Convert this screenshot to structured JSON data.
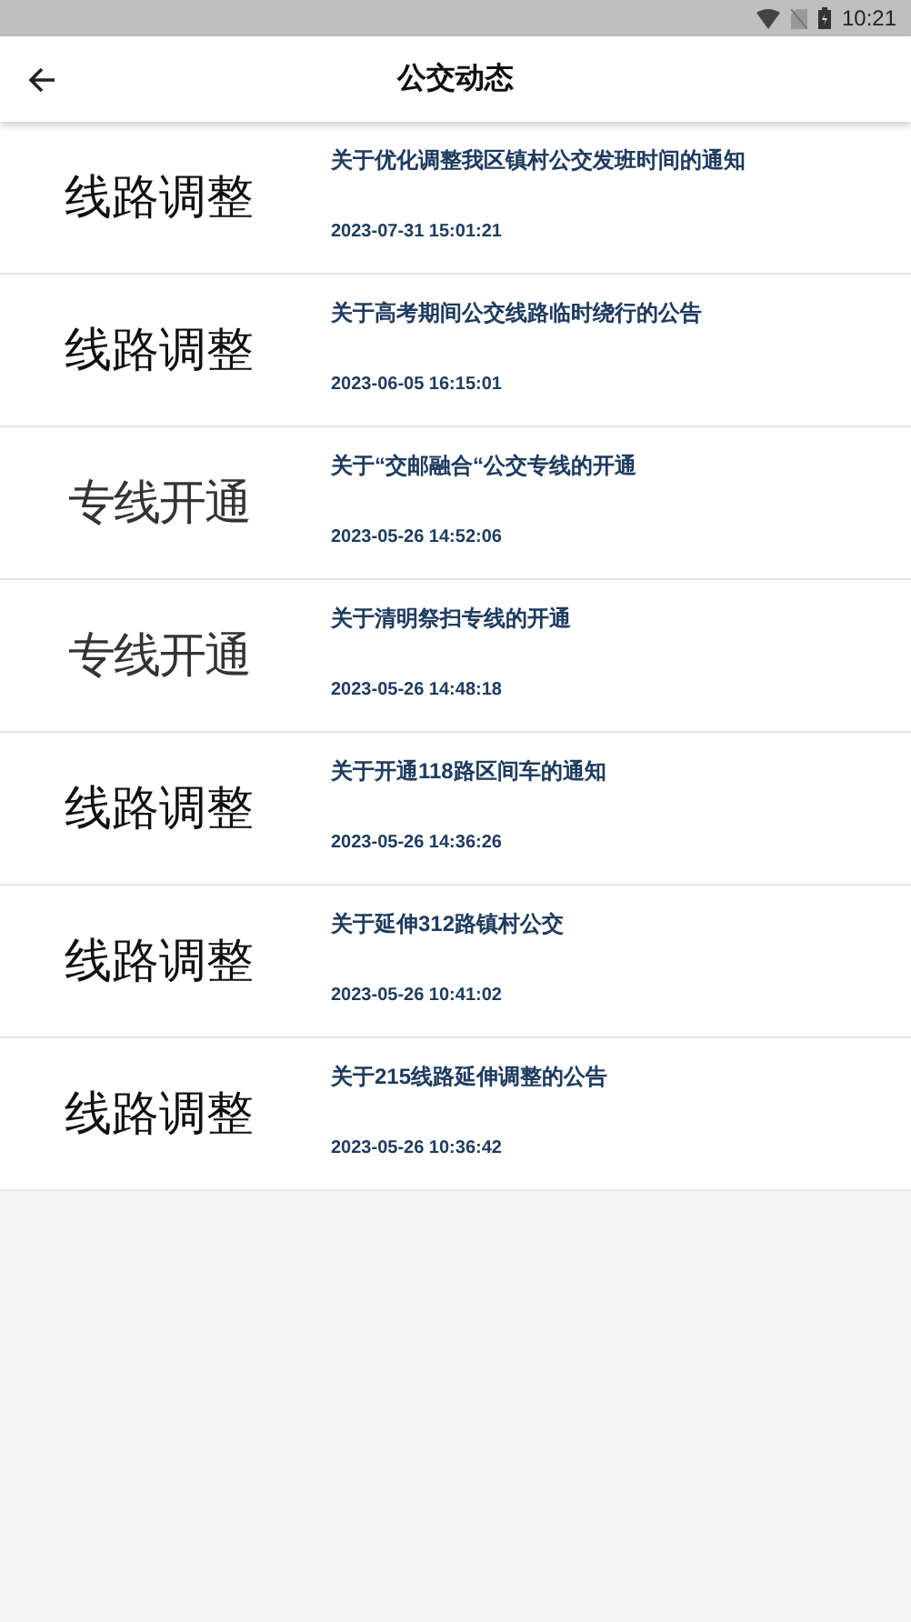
{
  "status_bar": {
    "time": "10:21"
  },
  "header": {
    "title": "公交动态"
  },
  "news": [
    {
      "category": "线路调整",
      "kind": "sans",
      "title": "关于优化调整我区镇村公交发班时间的通知",
      "date": "2023-07-31 15:01:21"
    },
    {
      "category": "线路调整",
      "kind": "sans",
      "title": "关于高考期间公交线路临时绕行的公告",
      "date": "2023-06-05 16:15:01"
    },
    {
      "category": "专线开通",
      "kind": "serif",
      "title": "关于“交邮融合“公交专线的开通",
      "date": "2023-05-26 14:52:06"
    },
    {
      "category": "专线开通",
      "kind": "serif",
      "title": "关于清明祭扫专线的开通",
      "date": "2023-05-26 14:48:18"
    },
    {
      "category": "线路调整",
      "kind": "sans",
      "title": "关于开通118路区间车的通知",
      "date": "2023-05-26 14:36:26"
    },
    {
      "category": "线路调整",
      "kind": "sans",
      "title": "关于延伸312路镇村公交",
      "date": "2023-05-26 10:41:02"
    },
    {
      "category": "线路调整",
      "kind": "sans",
      "title": "关于215线路延伸调整的公告",
      "date": "2023-05-26 10:36:42"
    }
  ]
}
